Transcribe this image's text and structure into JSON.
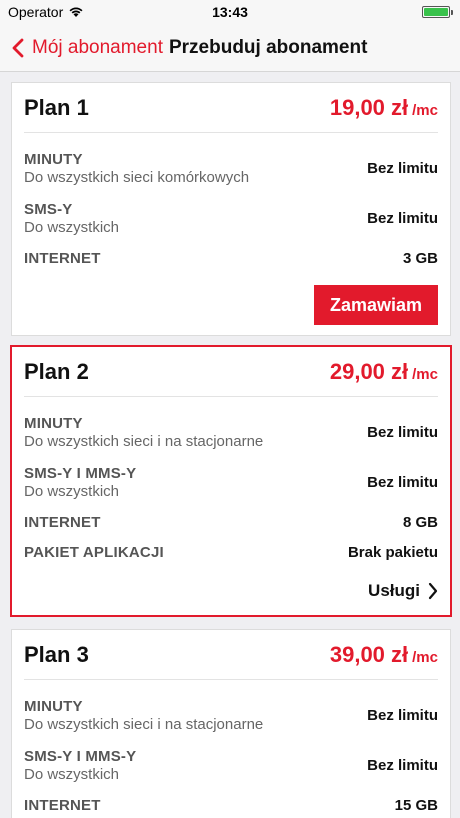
{
  "status_bar": {
    "carrier": "Operator",
    "time": "13:43"
  },
  "nav": {
    "back_label": "Mój abonament",
    "title": "Przebuduj abonament"
  },
  "plans": [
    {
      "name": "Plan 1",
      "price": "19,00 zł",
      "price_unit": "/mc",
      "rows": [
        {
          "label": "MINUTY",
          "sub": "Do wszystkich sieci komórkowych",
          "value": "Bez limitu"
        },
        {
          "label": "SMS-Y",
          "sub": "Do wszystkich",
          "value": "Bez limitu"
        },
        {
          "label": "INTERNET",
          "value": "3 GB"
        }
      ],
      "action_label": "Zamawiam"
    },
    {
      "name": "Plan 2",
      "price": "29,00 zł",
      "price_unit": "/mc",
      "rows": [
        {
          "label": "MINUTY",
          "sub": "Do wszystkich sieci i na stacjonarne",
          "value": "Bez limitu"
        },
        {
          "label": "SMS-Y I MMS-Y",
          "sub": "Do wszystkich",
          "value": "Bez limitu"
        },
        {
          "label": "INTERNET",
          "value": "8 GB"
        },
        {
          "label": "PAKIET APLIKACJI",
          "value": "Brak pakietu"
        }
      ],
      "services_label": "Usługi"
    },
    {
      "name": "Plan 3",
      "price": "39,00 zł",
      "price_unit": "/mc",
      "rows": [
        {
          "label": "MINUTY",
          "sub": "Do wszystkich sieci i na stacjonarne",
          "value": "Bez limitu"
        },
        {
          "label": "SMS-Y I MMS-Y",
          "sub": "Do wszystkich",
          "value": "Bez limitu"
        },
        {
          "label": "INTERNET",
          "value": "15 GB"
        }
      ]
    }
  ],
  "colors": {
    "accent": "#e21a2c",
    "battery": "#38c24b"
  }
}
